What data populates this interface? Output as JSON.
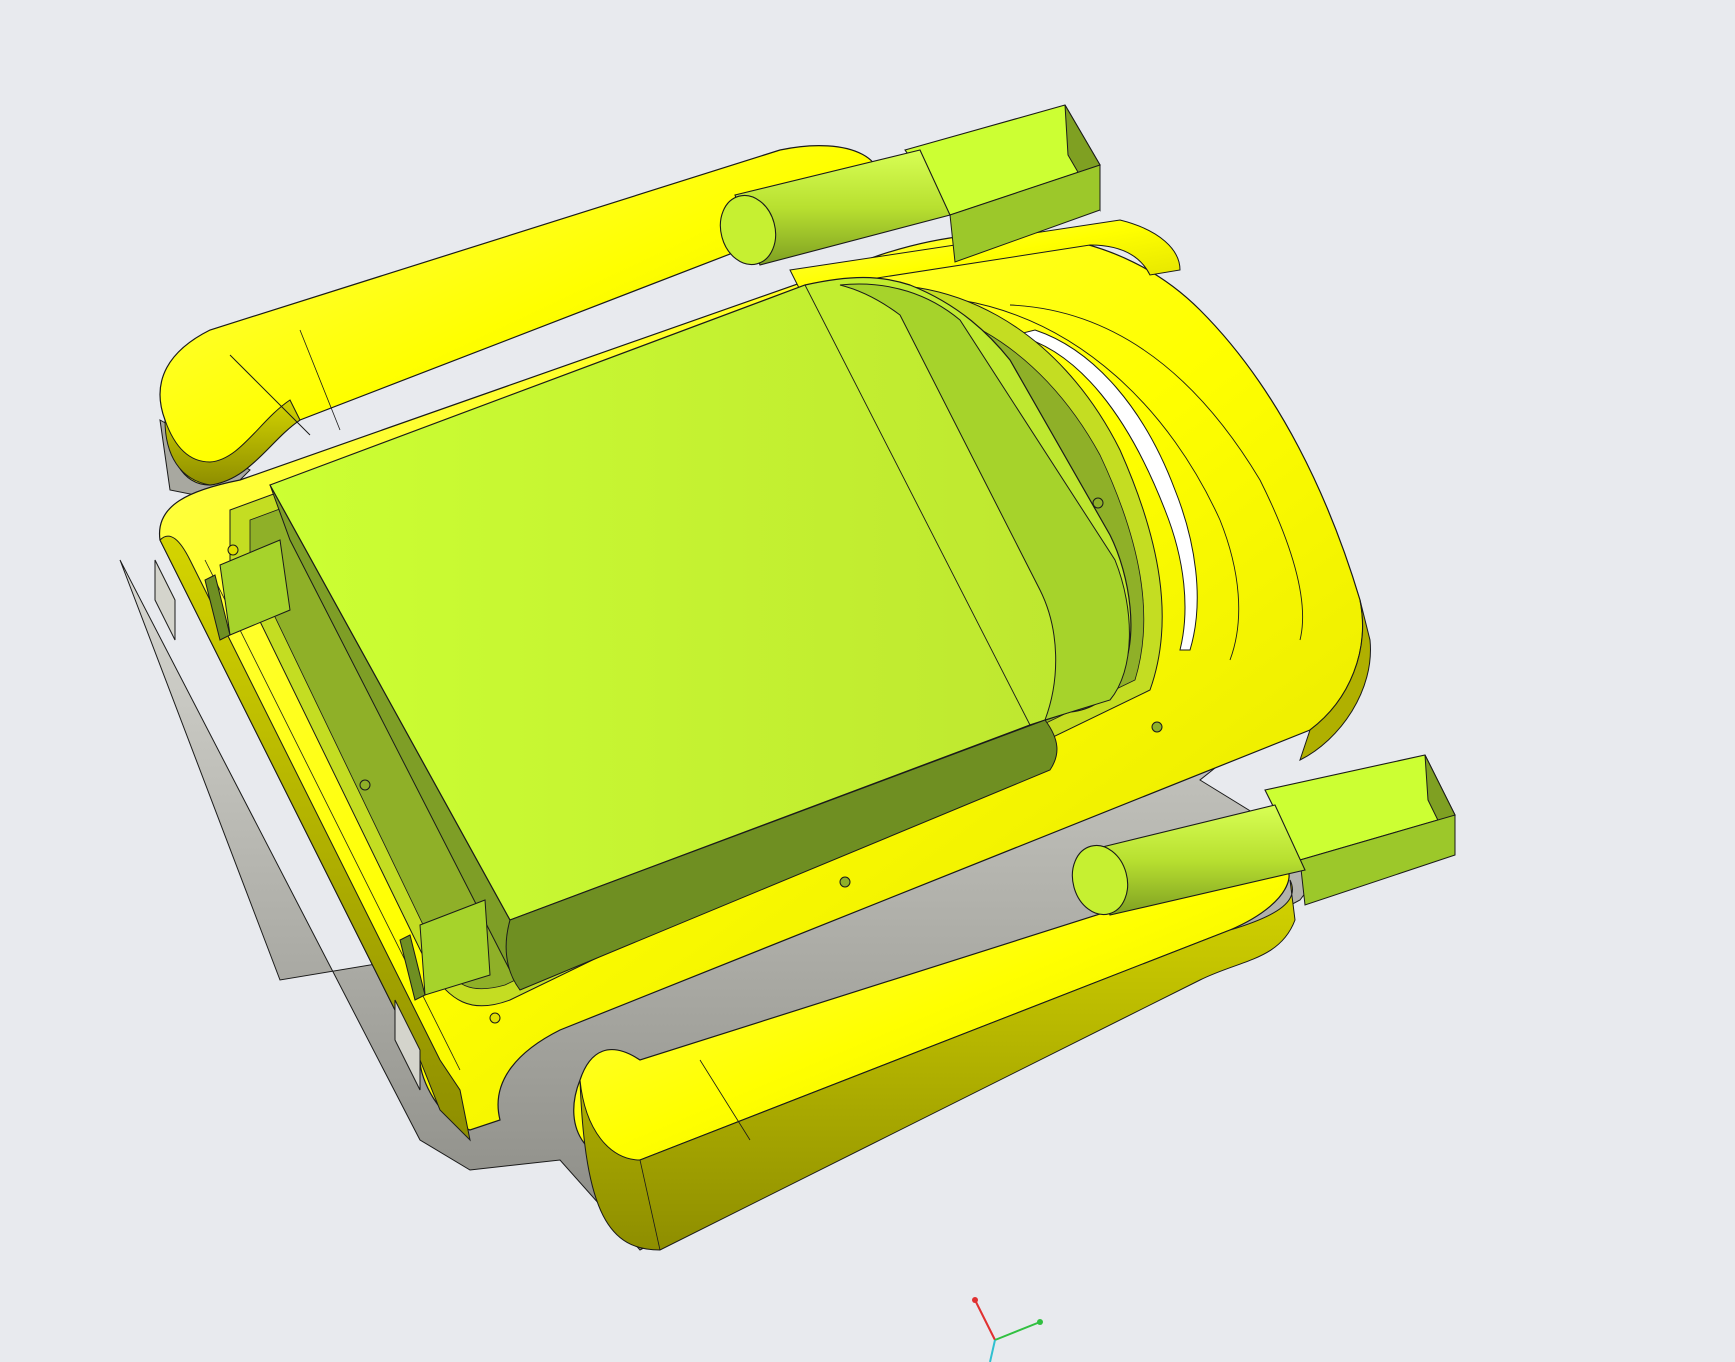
{
  "viewport": {
    "background_color": "#e8eaee",
    "render_mode": "shaded-with-edges"
  },
  "model": {
    "colors": {
      "housing_yellow": "#ffff00",
      "housing_yellow_shade": "#e6e600",
      "housing_dark_side": "#a3a300",
      "bottom_shell_grey": "#c8c8c0",
      "bottom_shell_dark": "#9a9a92",
      "part_lime": "#ccff33",
      "part_lime_mid": "#a8d42a",
      "part_lime_dark": "#6e8f22",
      "edge_line": "#1a1a1a"
    },
    "parts": [
      {
        "name": "lid",
        "icon": "box-icon"
      },
      {
        "name": "yellow-housing",
        "icon": "frame-icon"
      },
      {
        "name": "left-float",
        "icon": "capsule-icon"
      },
      {
        "name": "right-float",
        "icon": "capsule-icon"
      },
      {
        "name": "top-axle-block",
        "icon": "cylinder-icon"
      },
      {
        "name": "bottom-axle-block",
        "icon": "cylinder-icon"
      },
      {
        "name": "grey-bottom-shell",
        "icon": "shell-icon"
      }
    ]
  },
  "triad": {
    "x_color": "#e03030",
    "y_color": "#30c040",
    "z_color": "#30c0d0"
  }
}
